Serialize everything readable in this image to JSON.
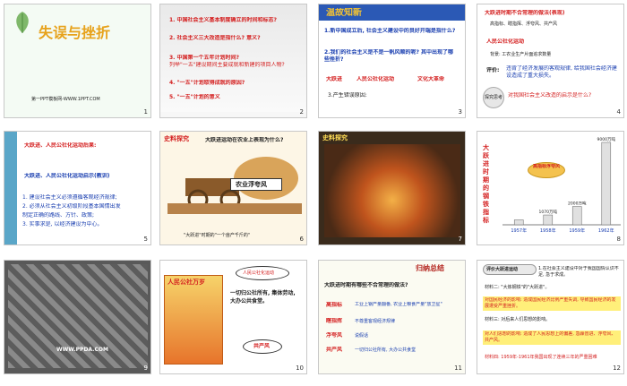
{
  "slides": [
    {
      "num": "1",
      "title": "失误与挫折",
      "footer": "第一PPT模板网-WWW.1PPT.COM"
    },
    {
      "num": "2",
      "items": [
        "1. 中国社会主义基本制度确立的时间和标志?",
        "2. 社会主义三大改造是指什么? 意义?",
        "3. 中国第一个五年计划时间?",
        "列举\"一五\"建设期间主要成就和新建的项目人物?",
        "4. \"一五\"计划取得成就的原因?",
        "5. \"一五\"计划的意义"
      ]
    },
    {
      "num": "3",
      "banner": "温故知新",
      "q1": "1.新中国成立后, 社会主义建设中的良好开端是指什么?",
      "q2": "2.我们的社会主义是不是一帆风顺的呢? 其中出现了哪些挫折?",
      "tags": [
        "大跃进",
        "人民公社化运动",
        "文化大革命"
      ],
      "q3": "3.产生错误原因:"
    },
    {
      "num": "4",
      "title": "大跃进时期不合常理的做法(表现)",
      "text1": "高指标、瞎指挥、浮夸风、共产风",
      "sub": "人民公社化运动",
      "text2": "背景: 工农业生产片面追求数量",
      "eval_label": "评价:",
      "eval_text": "违背了经济发展的客观规律, 给我国社会经济建设造成了重大损失。",
      "badge": "探究思考",
      "q": "对我国社会主义改造的启示是什么?"
    },
    {
      "num": "5",
      "t1": "大跃进、人民公社化运动后果:",
      "t2": "大跃进、人民公社化运动启示(教训)",
      "points": [
        "1. 建设社会主义必须遵循客观经济规律;",
        "2. 必须从社会主义初级阶段基本国情出发",
        "制定正确的路线、方针、政策;",
        "3. 实事求是, 以经济建设为中心。"
      ]
    },
    {
      "num": "6",
      "banner": "史料探究",
      "q": "大跃进运动在农业上表现为什么?",
      "label": "农业浮夸风",
      "caption": "\"大跃进\"时期的\"一个亩产千斤的\""
    },
    {
      "num": "7",
      "banner": "史料探究"
    },
    {
      "num": "8",
      "vlabel": "大跃进时期的钢铁指标",
      "callout": "高指标浮夸风",
      "chart_data": {
        "type": "bar",
        "categories": [
          "1957年",
          "1958年",
          "1959年",
          "1962年"
        ],
        "values": [
          535,
          1070,
          2000,
          9000
        ],
        "value_labels": [
          "",
          "1070万吨",
          "2000万吨",
          "9000万吨"
        ]
      }
    },
    {
      "num": "9",
      "watermark": "WWW.PPDA.COM"
    },
    {
      "num": "10",
      "poster": "人民公社万岁",
      "bubble1": "人民公社化运动",
      "desc": "一切归公社所有, 集体劳动, 大办公共食堂。",
      "bubble2": "共产风"
    },
    {
      "num": "11",
      "banner": "归纳总结",
      "q": "大跃进时期有哪些不合常理的做法?",
      "rows": [
        {
          "k": "高指标",
          "v": "工业上钢产量翻番, 农业上粮食产量\"放卫星\""
        },
        {
          "k": "瞎指挥",
          "v": "不尊重客观经济规律"
        },
        {
          "k": "浮夸风",
          "v": "说假话"
        },
        {
          "k": "共产风",
          "v": "一切归公社所有, 大办公共食堂"
        }
      ]
    },
    {
      "num": "12",
      "badge": "评价大跃进运动",
      "lines": [
        "1.在社会主义建设中对于我国国情认识不足, 急于求成。",
        "材料二: \"大炼钢铁\"的\"大跃进\"。",
        "对国民经济的影响: 造成国民经济比例严重失调, 导致国民经济的发展遭受严重挫折。",
        "材料三: 对后来人们思想的影响。",
        "对人们思想的影响: 造成了人民思想上的偏差, 急躁冒进、浮夸风、共产风。",
        "材料四: 1959年-1961年我国出现了连续三年的严重困难"
      ]
    }
  ]
}
